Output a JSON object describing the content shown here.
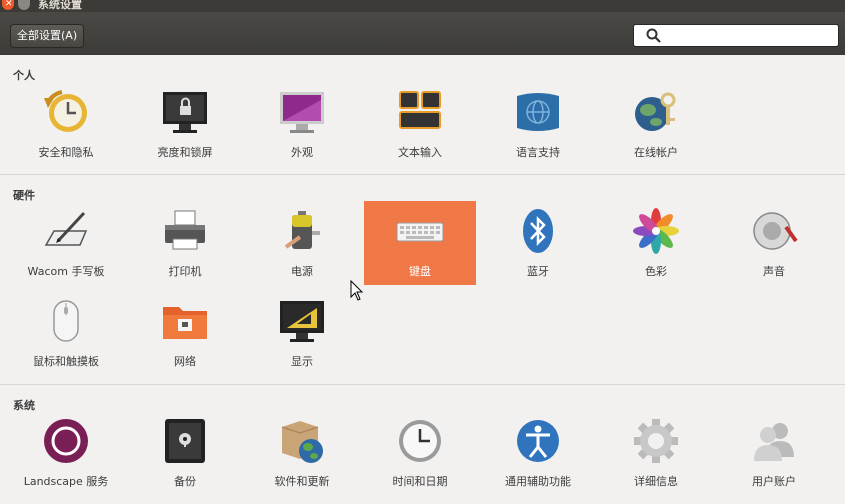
{
  "window": {
    "title": "系统设置"
  },
  "toolbar": {
    "all_settings_label": "全部设置(A)",
    "search_placeholder": ""
  },
  "sections": {
    "personal": {
      "title": "个人",
      "items": [
        "安全和隐私",
        "亮度和锁屏",
        "外观",
        "文本输入",
        "语言支持",
        "在线帐户"
      ]
    },
    "hardware": {
      "title": "硬件",
      "items": [
        "Wacom 手写板",
        "打印机",
        "电源",
        "键盘",
        "蓝牙",
        "色彩",
        "声音",
        "鼠标和触摸板",
        "网络",
        "显示"
      ]
    },
    "system": {
      "title": "系统",
      "items": [
        "Landscape 服务",
        "备份",
        "软件和更新",
        "时间和日期",
        "通用辅助功能",
        "详细信息",
        "用户账户"
      ]
    }
  },
  "selected_item": "键盘",
  "colors": {
    "selection": "#f07746",
    "titlebar": "#3c3b37",
    "close": "#f05a2a"
  }
}
